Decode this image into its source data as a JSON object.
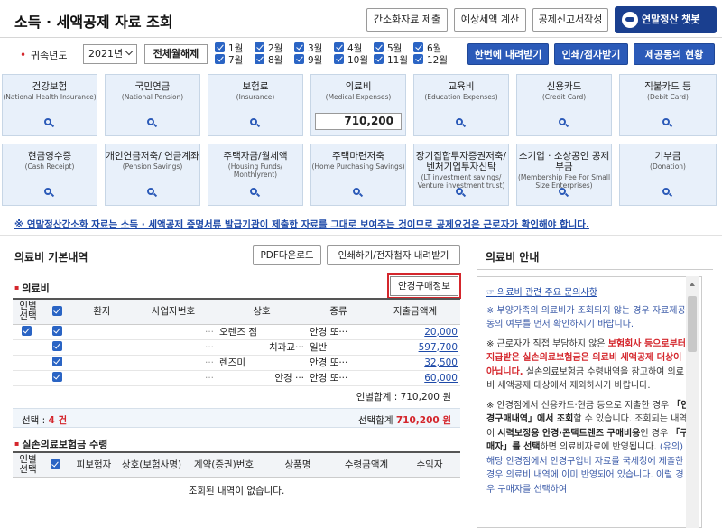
{
  "header": {
    "title": "소득 · 세액공제 자료 조회",
    "btn_simple": "간소화자료 제출",
    "btn_estimate": "예상세액 계산",
    "btn_report": "공제신고서작성",
    "btn_chat": "연말정산 챗봇"
  },
  "year_row": {
    "label": "귀속년도",
    "year_value": "2021년",
    "unselect_all": "전체월해제",
    "months": [
      "1월",
      "2월",
      "3월",
      "4월",
      "5월",
      "6월",
      "7월",
      "8월",
      "9월",
      "10월",
      "11월",
      "12월"
    ],
    "btn_download_all": "한번에 내려받기",
    "btn_print": "인쇄/점자받기",
    "btn_provider": "제공동의 현황"
  },
  "categories": [
    {
      "kr": "건강보험",
      "en": "(National Health Insurance)"
    },
    {
      "kr": "국민연금",
      "en": "(National Pension)"
    },
    {
      "kr": "보험료",
      "en": "(Insurance)"
    },
    {
      "kr": "의료비",
      "en": "(Medical Expenses)",
      "amount": "710,200"
    },
    {
      "kr": "교육비",
      "en": "(Education Expenses)"
    },
    {
      "kr": "신용카드",
      "en": "(Credit Card)"
    },
    {
      "kr": "직불카드 등",
      "en": "(Debit Card)"
    },
    {
      "kr": "현금영수증",
      "en": "(Cash Receipt)"
    },
    {
      "kr": "개인연금저축/ 연금계좌",
      "en": "(Pension Savings)"
    },
    {
      "kr": "주택자금/월세액",
      "en": "(Housing Funds/ Monthlyrent)"
    },
    {
      "kr": "주택마련저축",
      "en": "(Home Purchasing Savings)"
    },
    {
      "kr": "장기집합투자증권저축/ 벤처기업투자신탁",
      "en": "(LT investment savings/ Venture investment trust)"
    },
    {
      "kr": "소기업 · 소상공인 공제부금",
      "en": "(Membership Fee For Small Size Enterprises)"
    },
    {
      "kr": "기부금",
      "en": "(Donation)"
    }
  ],
  "notice": "※ 연말정산간소화 자료는 소득 · 세액공제 증명서류 발급기관이 제출한 자료를 그대로 보여주는 것이므로 공제요건은 근로자가 확인해야 합니다.",
  "left": {
    "title": "의료비 기본내역",
    "btn_pdf": "PDF다운로드",
    "btn_print_dl": "인쇄하기/전자첨자 내려받기",
    "section_medical": "의료비",
    "btn_glasses": "안경구매정보",
    "columns": [
      "인별 선택",
      "",
      "환자",
      "사업자번호",
      "상호",
      "종류",
      "지출금액계"
    ],
    "rows": [
      {
        "biz": "···",
        "name": "오렌즈   점",
        "type": "안경 또···",
        "amount": "20,000"
      },
      {
        "biz": "···",
        "name": "치과교···",
        "type": "일반",
        "amount": "597,700"
      },
      {
        "biz": "···",
        "name": "렌즈미",
        "type": "안경 또···",
        "amount": "32,500"
      },
      {
        "biz": "···",
        "name": "안경 ···",
        "type": "안경 또···",
        "amount": "60,000"
      }
    ],
    "person_total": "인별합계 : 710,200 원",
    "selected_label": "선택 :",
    "selected_count": "4 건",
    "selected_total_label": "선택합계",
    "selected_total": "710,200 원",
    "section_insurance": "실손의료보험금 수령",
    "columns2": [
      "인별 선택",
      "",
      "피보험자",
      "상호(보험사명)",
      "계약(증권)번호",
      "상품명",
      "수령금액계",
      "수익자"
    ],
    "empty_msg": "조회된 내역이 없습니다."
  },
  "right": {
    "title": "의료비 안내",
    "link": "의료비 관련 주요 문의사항",
    "p1": "※ 부양가족의 의료비가 조회되지 않는 경우 자료제공동의 여부를 먼저 확인하시기 바랍니다.",
    "p2a": "※ 근로자가 직접 부담하지 않은 ",
    "p2b": "보험회사 등으로부터 지급받은 실손의료보험금은 의료비 세액공제 대상이 아닙니다.",
    "p2c": " 실손의료보험금 수령내역을 참고하여 의료비 세액공제 대상에서 제외하시기 바랍니다.",
    "p3a": "※ 안경점에서 신용카드·현금 등으로 지출한 경우 ",
    "p3b": "「안경구매내역」에서 조회",
    "p3c": "할 수 있습니다. 조회되는 내역이 ",
    "p3d": "시력보정용 안경·콘택트렌즈 구매비용",
    "p3e": "인 경우 ",
    "p3f": "「구매자」를 선택",
    "p3g": "하면 의료비자료에 반영됩니다. ",
    "p3h": "(유의) 해당 안경점에서 안경구입비 자료를 국세청에 제출한 경우 의료비 내역에 이미 반영되어 있습니다. 이럴 경우 구매자를 선택하여"
  }
}
